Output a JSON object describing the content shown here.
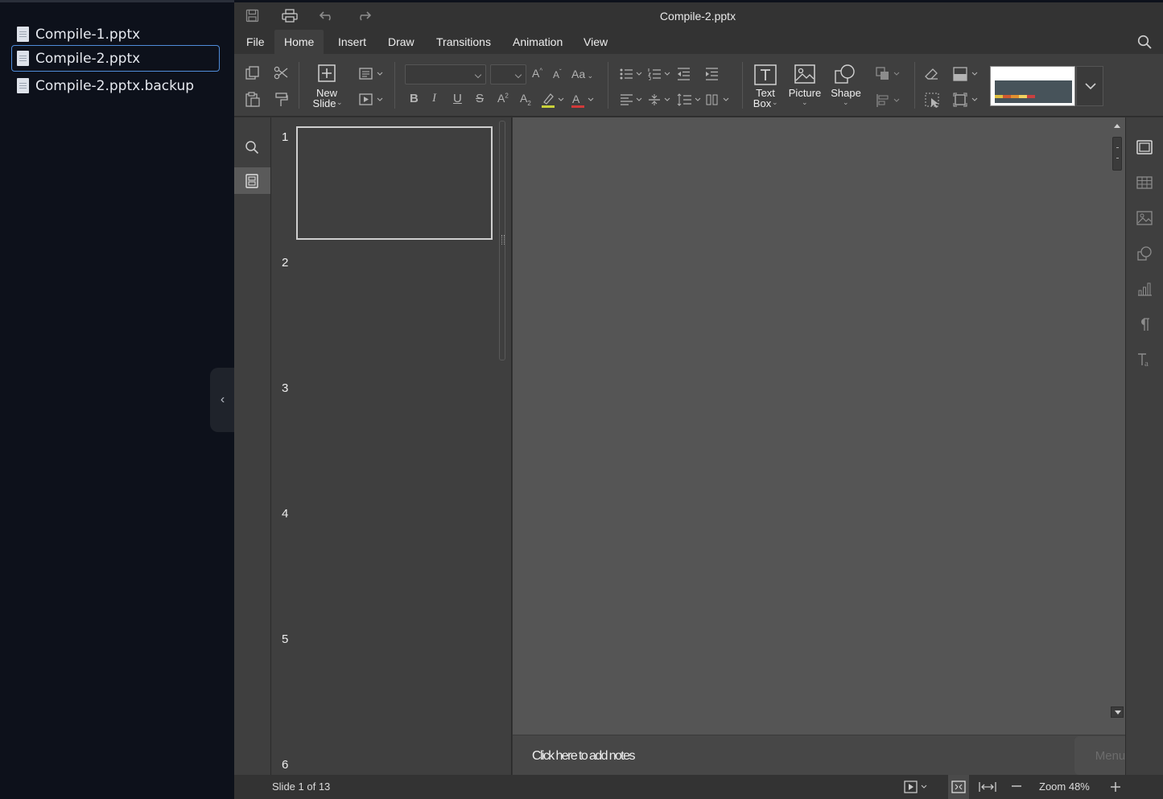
{
  "files": [
    {
      "name": "Compile-1.pptx",
      "active": false
    },
    {
      "name": "Compile-2.pptx",
      "active": true
    },
    {
      "name": "Compile-2.pptx.backup",
      "active": false
    }
  ],
  "collapse_glyph": "‹",
  "window": {
    "title": "Compile-2.pptx"
  },
  "menu": {
    "tabs": [
      "File",
      "Home",
      "Insert",
      "Draw",
      "Transitions",
      "Animation",
      "View"
    ],
    "active": "Home"
  },
  "ribbon": {
    "new_slide_label_1": "New",
    "new_slide_label_2": "Slide",
    "text_box_label_1": "Text",
    "text_box_label_2": "Box",
    "picture_label": "Picture",
    "shape_label": "Shape",
    "font_name": "",
    "font_size": ""
  },
  "thumbnails": {
    "slide_numbers": [
      "1",
      "2",
      "3",
      "4",
      "5",
      "6"
    ]
  },
  "notes": {
    "placeholder": "Click here to add notes"
  },
  "menu_ghost": "Menu",
  "status": {
    "slide_indicator": "Slide 1 of 13",
    "zoom": "Zoom 48%"
  },
  "colors": {
    "sidebar_bg": "#0d111b",
    "app_bg": "#333333",
    "ribbon_bg": "#3f3f3f",
    "canvas_bg": "#555555",
    "active_file_border": "#4f8cd9"
  }
}
